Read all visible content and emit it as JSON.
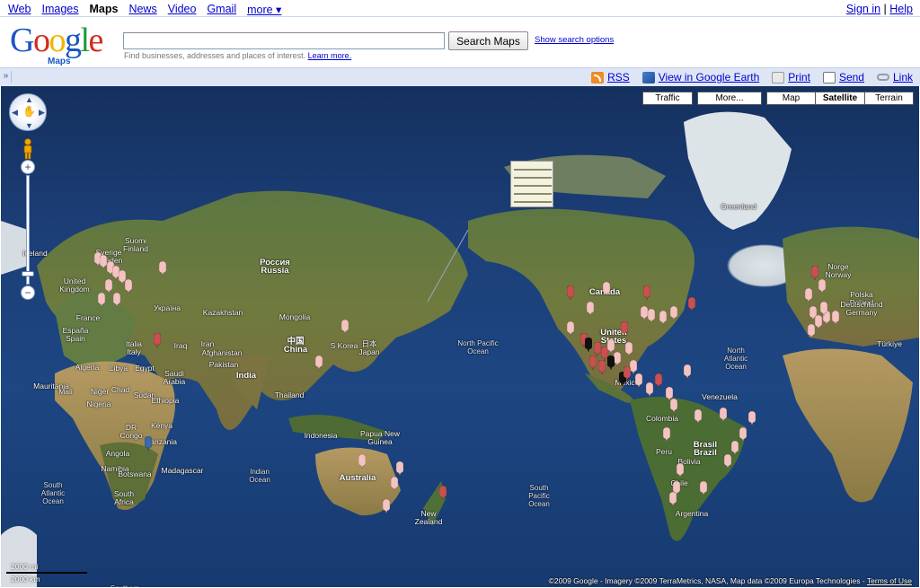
{
  "topnav": {
    "links": [
      "Web",
      "Images",
      "Maps",
      "News",
      "Video",
      "Gmail",
      "more ▾"
    ],
    "current": "Maps",
    "sign_in": "Sign in",
    "separator": "|",
    "help": "Help"
  },
  "header": {
    "logo_text": "Google",
    "logo_sub": "Maps",
    "search_value": "",
    "search_button": "Search Maps",
    "show_options": "Show search options",
    "hint": "Find businesses, addresses and places of interest.",
    "learn_more": "Learn more."
  },
  "toolbar": {
    "toggle": "»",
    "rss": "RSS",
    "earth": "View in Google Earth",
    "print": "Print",
    "send": "Send",
    "link": "Link"
  },
  "map": {
    "buttons": [
      "Traffic",
      "More...",
      "Map",
      "Satellite",
      "Terrain"
    ],
    "active_button": "Satellite",
    "labels": [
      {
        "t": "Suomi\nFinland"
      },
      {
        "t": "Sverige\nSweden"
      },
      {
        "t": "Iceland"
      },
      {
        "t": "United\nKingdom"
      },
      {
        "t": "France"
      },
      {
        "t": "España\nSpain"
      },
      {
        "t": "Italia\nItaly"
      },
      {
        "t": "Україна"
      },
      {
        "t": "Россия\nRussia"
      },
      {
        "t": "Kazakhstan"
      },
      {
        "t": "Mongolia"
      },
      {
        "t": "中国\nChina"
      },
      {
        "t": "S Korea"
      },
      {
        "t": "日本\nJapan"
      },
      {
        "t": "India"
      },
      {
        "t": "Afghanistan"
      },
      {
        "t": "Pakistan"
      },
      {
        "t": "Iran"
      },
      {
        "t": "Iraq"
      },
      {
        "t": "Saudi\nArabia"
      },
      {
        "t": "Thailand"
      },
      {
        "t": "Indonesia"
      },
      {
        "t": "Papua New\nGuinea"
      },
      {
        "t": "Australia"
      },
      {
        "t": "New\nZealand"
      },
      {
        "t": "Algeria"
      },
      {
        "t": "Libya"
      },
      {
        "t": "Egypt"
      },
      {
        "t": "Mali"
      },
      {
        "t": "Niger"
      },
      {
        "t": "Chad"
      },
      {
        "t": "Sudan"
      },
      {
        "t": "Nigeria"
      },
      {
        "t": "Ethiopia"
      },
      {
        "t": "DR\nCongo"
      },
      {
        "t": "Kenya"
      },
      {
        "t": "Tanzania"
      },
      {
        "t": "Angola"
      },
      {
        "t": "Namibia"
      },
      {
        "t": "Botswana"
      },
      {
        "t": "Madagascar"
      },
      {
        "t": "South\nAfrica"
      },
      {
        "t": "Mauritania"
      },
      {
        "t": "Canada"
      },
      {
        "t": "United\nStates"
      },
      {
        "t": "Mexico"
      },
      {
        "t": "Colombia"
      },
      {
        "t": "Peru"
      },
      {
        "t": "Brasil\nBrazil"
      },
      {
        "t": "Bolivia"
      },
      {
        "t": "Chile"
      },
      {
        "t": "Argentina"
      },
      {
        "t": "Greenland"
      },
      {
        "t": "North Pacific\nOcean"
      },
      {
        "t": "North\nAtlantic\nOcean"
      },
      {
        "t": "South\nAtlantic\nOcean"
      },
      {
        "t": "South\nPacific\nOcean"
      },
      {
        "t": "Indian\nOcean"
      },
      {
        "t": "Southern\nOcean"
      },
      {
        "t": "Norge\nNorway"
      },
      {
        "t": "Polska\nPoland"
      },
      {
        "t": "Deutschland\nGermany"
      },
      {
        "t": "Türkiye"
      },
      {
        "t": "Venezuela"
      }
    ],
    "scale_mi": "2000 mi",
    "scale_km": "2000 km",
    "copyright": "©2009 Google - Imagery ©2009 TerraMetrics, NASA, Map data ©2009 Europa Technologies -",
    "terms": "Terms of Use",
    "colors": {
      "ocean": "#1c3f78",
      "land": "#5f7a3c",
      "pin_light": "#f5c2c2",
      "pin_dark": "#c85050",
      "pin_black": "#111111",
      "pin_blue": "#3a6aa8"
    }
  }
}
